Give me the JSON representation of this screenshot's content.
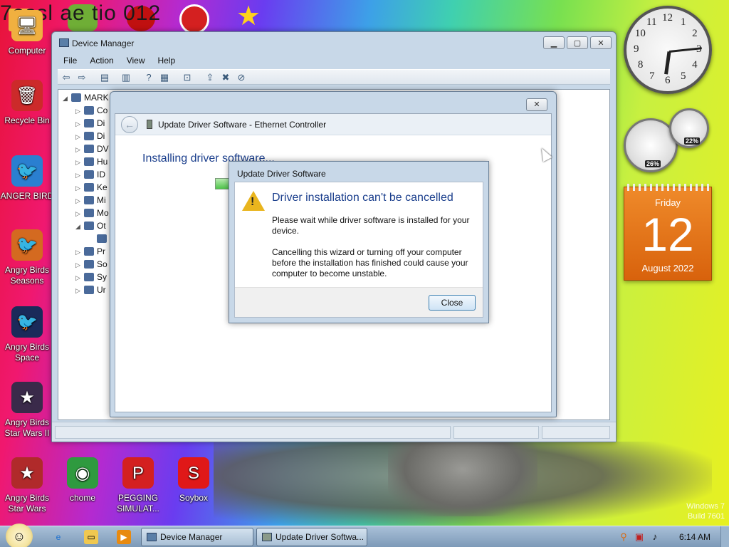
{
  "desktop": {
    "banner_text": "7ossl ae tio 012",
    "icons": [
      {
        "label": "Computer",
        "color": "#f0b040",
        "glyph": "🖥"
      },
      {
        "label": "Recycle Bin",
        "color": "#cc2a2a",
        "glyph": "🗑"
      },
      {
        "label": "ANGER BIRD",
        "color": "#2a7fd0",
        "glyph": "🐦"
      },
      {
        "label": "Angry Birds Seasons",
        "color": "#d46a20",
        "glyph": "🐦"
      },
      {
        "label": "Angry Birds Space",
        "color": "#1a2a5a",
        "glyph": "🐦"
      },
      {
        "label": "Angry Birds Star Wars II",
        "color": "#3a2a4a",
        "glyph": "★"
      },
      {
        "label": "Angry Birds Star Wars",
        "color": "#b02a2a",
        "glyph": "★"
      },
      {
        "label": "chome",
        "color": "#2f9a3f",
        "glyph": "◉"
      },
      {
        "label": "PEGGING SIMULAT...",
        "color": "#d42020",
        "glyph": "P"
      },
      {
        "label": "Soybox",
        "color": "#e01818",
        "glyph": "S"
      }
    ],
    "watermark_line1": "Windows 7",
    "watermark_line2": "Build 7601"
  },
  "device_manager": {
    "title": "Device Manager",
    "menu": [
      "File",
      "Action",
      "View",
      "Help"
    ],
    "toolbar_icons": [
      "back-icon",
      "forward-icon",
      "show-hide-tree-icon",
      "properties-icon",
      "help-icon",
      "view-icon",
      "scan-hardware-icon",
      "update-driver-icon",
      "uninstall-icon",
      "disable-icon"
    ],
    "tree": [
      {
        "label": "MARK",
        "expander": "◢",
        "indent": 0
      },
      {
        "label": "Co",
        "expander": "▷",
        "indent": 1
      },
      {
        "label": "Di",
        "expander": "▷",
        "indent": 1
      },
      {
        "label": "Di",
        "expander": "▷",
        "indent": 1
      },
      {
        "label": "DV",
        "expander": "▷",
        "indent": 1
      },
      {
        "label": "Hu",
        "expander": "▷",
        "indent": 1
      },
      {
        "label": "ID",
        "expander": "▷",
        "indent": 1
      },
      {
        "label": "Ke",
        "expander": "▷",
        "indent": 1
      },
      {
        "label": "Mi",
        "expander": "▷",
        "indent": 1
      },
      {
        "label": "Mo",
        "expander": "▷",
        "indent": 1
      },
      {
        "label": "Ot",
        "expander": "◢",
        "indent": 1
      },
      {
        "label": "",
        "expander": "",
        "indent": 2
      },
      {
        "label": "Pr",
        "expander": "▷",
        "indent": 1
      },
      {
        "label": "So",
        "expander": "▷",
        "indent": 1
      },
      {
        "label": "Sy",
        "expander": "▷",
        "indent": 1
      },
      {
        "label": "Ur",
        "expander": "▷",
        "indent": 1
      }
    ]
  },
  "update_driver": {
    "header_title": "Update Driver Software - Ethernet Controller",
    "installing_text": "Installing driver software..."
  },
  "message_box": {
    "title": "Update Driver Software",
    "heading": "Driver installation can't be cancelled",
    "text1": "Please wait while driver software is installed for your device.",
    "text2": "Cancelling this wizard or turning off your computer before the installation has finished could cause your computer to become unstable.",
    "close_label": "Close"
  },
  "gadgets": {
    "clock_numbers": [
      "12",
      "1",
      "2",
      "3",
      "4",
      "5",
      "6",
      "7",
      "8",
      "9",
      "10",
      "11"
    ],
    "cpu_percent": "26%",
    "memory_percent": "22%",
    "calendar_day": "Friday",
    "calendar_date": "12",
    "calendar_month_year": "August 2022"
  },
  "taskbar": {
    "buttons": [
      "Device Manager",
      "Update Driver Softwa..."
    ],
    "time": "6:14 AM"
  }
}
